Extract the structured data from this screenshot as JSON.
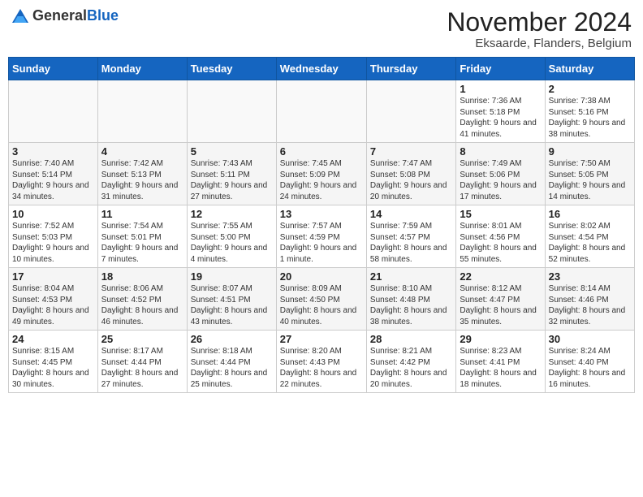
{
  "logo": {
    "general": "General",
    "blue": "Blue"
  },
  "header": {
    "month": "November 2024",
    "location": "Eksaarde, Flanders, Belgium"
  },
  "weekdays": [
    "Sunday",
    "Monday",
    "Tuesday",
    "Wednesday",
    "Thursday",
    "Friday",
    "Saturday"
  ],
  "weeks": [
    [
      {
        "day": "",
        "info": ""
      },
      {
        "day": "",
        "info": ""
      },
      {
        "day": "",
        "info": ""
      },
      {
        "day": "",
        "info": ""
      },
      {
        "day": "",
        "info": ""
      },
      {
        "day": "1",
        "info": "Sunrise: 7:36 AM\nSunset: 5:18 PM\nDaylight: 9 hours and 41 minutes."
      },
      {
        "day": "2",
        "info": "Sunrise: 7:38 AM\nSunset: 5:16 PM\nDaylight: 9 hours and 38 minutes."
      }
    ],
    [
      {
        "day": "3",
        "info": "Sunrise: 7:40 AM\nSunset: 5:14 PM\nDaylight: 9 hours and 34 minutes."
      },
      {
        "day": "4",
        "info": "Sunrise: 7:42 AM\nSunset: 5:13 PM\nDaylight: 9 hours and 31 minutes."
      },
      {
        "day": "5",
        "info": "Sunrise: 7:43 AM\nSunset: 5:11 PM\nDaylight: 9 hours and 27 minutes."
      },
      {
        "day": "6",
        "info": "Sunrise: 7:45 AM\nSunset: 5:09 PM\nDaylight: 9 hours and 24 minutes."
      },
      {
        "day": "7",
        "info": "Sunrise: 7:47 AM\nSunset: 5:08 PM\nDaylight: 9 hours and 20 minutes."
      },
      {
        "day": "8",
        "info": "Sunrise: 7:49 AM\nSunset: 5:06 PM\nDaylight: 9 hours and 17 minutes."
      },
      {
        "day": "9",
        "info": "Sunrise: 7:50 AM\nSunset: 5:05 PM\nDaylight: 9 hours and 14 minutes."
      }
    ],
    [
      {
        "day": "10",
        "info": "Sunrise: 7:52 AM\nSunset: 5:03 PM\nDaylight: 9 hours and 10 minutes."
      },
      {
        "day": "11",
        "info": "Sunrise: 7:54 AM\nSunset: 5:01 PM\nDaylight: 9 hours and 7 minutes."
      },
      {
        "day": "12",
        "info": "Sunrise: 7:55 AM\nSunset: 5:00 PM\nDaylight: 9 hours and 4 minutes."
      },
      {
        "day": "13",
        "info": "Sunrise: 7:57 AM\nSunset: 4:59 PM\nDaylight: 9 hours and 1 minute."
      },
      {
        "day": "14",
        "info": "Sunrise: 7:59 AM\nSunset: 4:57 PM\nDaylight: 8 hours and 58 minutes."
      },
      {
        "day": "15",
        "info": "Sunrise: 8:01 AM\nSunset: 4:56 PM\nDaylight: 8 hours and 55 minutes."
      },
      {
        "day": "16",
        "info": "Sunrise: 8:02 AM\nSunset: 4:54 PM\nDaylight: 8 hours and 52 minutes."
      }
    ],
    [
      {
        "day": "17",
        "info": "Sunrise: 8:04 AM\nSunset: 4:53 PM\nDaylight: 8 hours and 49 minutes."
      },
      {
        "day": "18",
        "info": "Sunrise: 8:06 AM\nSunset: 4:52 PM\nDaylight: 8 hours and 46 minutes."
      },
      {
        "day": "19",
        "info": "Sunrise: 8:07 AM\nSunset: 4:51 PM\nDaylight: 8 hours and 43 minutes."
      },
      {
        "day": "20",
        "info": "Sunrise: 8:09 AM\nSunset: 4:50 PM\nDaylight: 8 hours and 40 minutes."
      },
      {
        "day": "21",
        "info": "Sunrise: 8:10 AM\nSunset: 4:48 PM\nDaylight: 8 hours and 38 minutes."
      },
      {
        "day": "22",
        "info": "Sunrise: 8:12 AM\nSunset: 4:47 PM\nDaylight: 8 hours and 35 minutes."
      },
      {
        "day": "23",
        "info": "Sunrise: 8:14 AM\nSunset: 4:46 PM\nDaylight: 8 hours and 32 minutes."
      }
    ],
    [
      {
        "day": "24",
        "info": "Sunrise: 8:15 AM\nSunset: 4:45 PM\nDaylight: 8 hours and 30 minutes."
      },
      {
        "day": "25",
        "info": "Sunrise: 8:17 AM\nSunset: 4:44 PM\nDaylight: 8 hours and 27 minutes."
      },
      {
        "day": "26",
        "info": "Sunrise: 8:18 AM\nSunset: 4:44 PM\nDaylight: 8 hours and 25 minutes."
      },
      {
        "day": "27",
        "info": "Sunrise: 8:20 AM\nSunset: 4:43 PM\nDaylight: 8 hours and 22 minutes."
      },
      {
        "day": "28",
        "info": "Sunrise: 8:21 AM\nSunset: 4:42 PM\nDaylight: 8 hours and 20 minutes."
      },
      {
        "day": "29",
        "info": "Sunrise: 8:23 AM\nSunset: 4:41 PM\nDaylight: 8 hours and 18 minutes."
      },
      {
        "day": "30",
        "info": "Sunrise: 8:24 AM\nSunset: 4:40 PM\nDaylight: 8 hours and 16 minutes."
      }
    ]
  ]
}
